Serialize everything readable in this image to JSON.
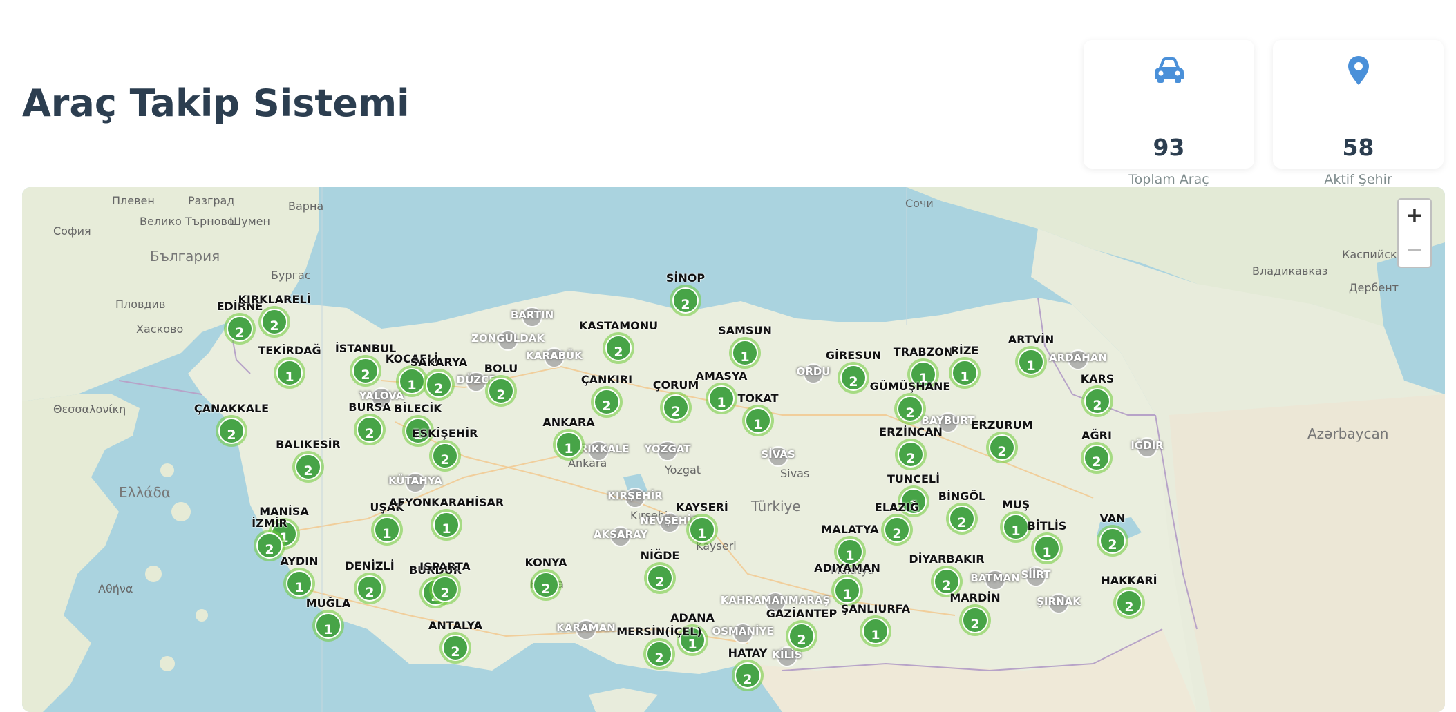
{
  "header": {
    "title": "Araç Takip Sistemi"
  },
  "stats": [
    {
      "icon": "car-icon",
      "value": "93",
      "label": "Toplam Araç",
      "color": "#4a90d9"
    },
    {
      "icon": "map-pin-icon",
      "value": "58",
      "label": "Aktif Şehir",
      "color": "#4a90d9"
    }
  ],
  "zoom": {
    "in": "+",
    "out": "−"
  },
  "colors": {
    "marker": "#47a447",
    "marker_halo": "#6ecc39",
    "inactive": "#a9a9a9",
    "water": "#aad3df",
    "land": "#e8eedd",
    "title": "#2c3e50"
  },
  "active_cities": [
    {
      "name": "EDİRNE",
      "count": "2"
    },
    {
      "name": "KIRKLARELİ",
      "count": "2"
    },
    {
      "name": "TEKİRDAĞ",
      "count": "1"
    },
    {
      "name": "İSTANBUL",
      "count": "2"
    },
    {
      "name": "KOCAELİ",
      "count": "1"
    },
    {
      "name": "SAKARYA",
      "count": "2"
    },
    {
      "name": "BOLU",
      "count": "2"
    },
    {
      "name": "KASTAMONU",
      "count": "2"
    },
    {
      "name": "SİNOP",
      "count": "2"
    },
    {
      "name": "SAMSUN",
      "count": "1"
    },
    {
      "name": "ÇANKIRI",
      "count": "2"
    },
    {
      "name": "ÇORUM",
      "count": "2"
    },
    {
      "name": "AMASYA",
      "count": "1"
    },
    {
      "name": "TOKAT",
      "count": "1"
    },
    {
      "name": "GİRESUN",
      "count": "2"
    },
    {
      "name": "TRABZON",
      "count": "1"
    },
    {
      "name": "RİZE",
      "count": "1"
    },
    {
      "name": "ARTVİN",
      "count": "1"
    },
    {
      "name": "KARS",
      "count": "2"
    },
    {
      "name": "GÜMÜŞHANE",
      "count": "2"
    },
    {
      "name": "ERZİNCAN",
      "count": "2"
    },
    {
      "name": "ERZURUM",
      "count": "2"
    },
    {
      "name": "AĞRI",
      "count": "2"
    },
    {
      "name": "ÇANAKKALE",
      "count": "2"
    },
    {
      "name": "BURSA",
      "count": "2"
    },
    {
      "name": "BİLECİK",
      "count": "1"
    },
    {
      "name": "ESKİŞEHİR",
      "count": "2"
    },
    {
      "name": "ANKARA",
      "count": "1"
    },
    {
      "name": "BALIKESİR",
      "count": "2"
    },
    {
      "name": "MANİSA",
      "count": "1"
    },
    {
      "name": "İZMİR",
      "count": "2"
    },
    {
      "name": "UŞAK",
      "count": "1"
    },
    {
      "name": "AFYONKARAHİSAR",
      "count": "1"
    },
    {
      "name": "KAYSERİ",
      "count": "1"
    },
    {
      "name": "TUNCELİ",
      "count": "1"
    },
    {
      "name": "BİNGÖL",
      "count": "2"
    },
    {
      "name": "ELAZIĞ",
      "count": "2"
    },
    {
      "name": "MUŞ",
      "count": "1"
    },
    {
      "name": "BİTLİS",
      "count": "1"
    },
    {
      "name": "VAN",
      "count": "2"
    },
    {
      "name": "MALATYA",
      "count": "1"
    },
    {
      "name": "AYDIN",
      "count": "1"
    },
    {
      "name": "DENİZLİ",
      "count": "2"
    },
    {
      "name": "BURDUR",
      "count": "2"
    },
    {
      "name": "ISPARTA",
      "count": "2"
    },
    {
      "name": "KONYA",
      "count": "2"
    },
    {
      "name": "NİĞDE",
      "count": "2"
    },
    {
      "name": "ADIYAMAN",
      "count": "1"
    },
    {
      "name": "DİYARBAKIR",
      "count": "2"
    },
    {
      "name": "HAKKARİ",
      "count": "2"
    },
    {
      "name": "MUĞLA",
      "count": "1"
    },
    {
      "name": "ANTALYA",
      "count": "2"
    },
    {
      "name": "ADANA",
      "count": "1"
    },
    {
      "name": "MERSİN(İÇEL)",
      "count": "2"
    },
    {
      "name": "GAZİANTEP",
      "count": "2"
    },
    {
      "name": "ŞANLIURFA",
      "count": "1"
    },
    {
      "name": "MARDİN",
      "count": "2"
    },
    {
      "name": "HATAY",
      "count": "2"
    }
  ],
  "inactive_cities": [
    "BARTIN",
    "ZONGULDAK",
    "KARABÜK",
    "DÜZCE",
    "YALOVA",
    "ORDU",
    "ARDAHAN",
    "BAYBURT",
    "IĞDIR",
    "KIRIKKALE",
    "YOZGAT",
    "SİVAS",
    "KÜTAHYA",
    "KIRŞEHİR",
    "NEVŞEHİR",
    "AKSARAY",
    "KARAMAN",
    "BATMAN",
    "SİİRT",
    "ŞIRNAK",
    "KAHRAMANMARAŞ",
    "OSMANİYE",
    "KİLİS"
  ],
  "map_labels": [
    "Плевен",
    "Разград",
    "Варна",
    "Велико Търново",
    "Шумен",
    "София",
    "България",
    "Бургас",
    "Пловдив",
    "Хасково",
    "Сочи",
    "Владикавказ",
    "Дербент",
    "Каспийск",
    "Azərbaycan",
    "Türkiye",
    "Konya",
    "Sivas",
    "Kayseri",
    "Malatya",
    "Ankara",
    "Kırşehir",
    "Yozgat",
    "Αθήνα",
    "Θεσσαλονίκη",
    "Ελλάδα"
  ]
}
